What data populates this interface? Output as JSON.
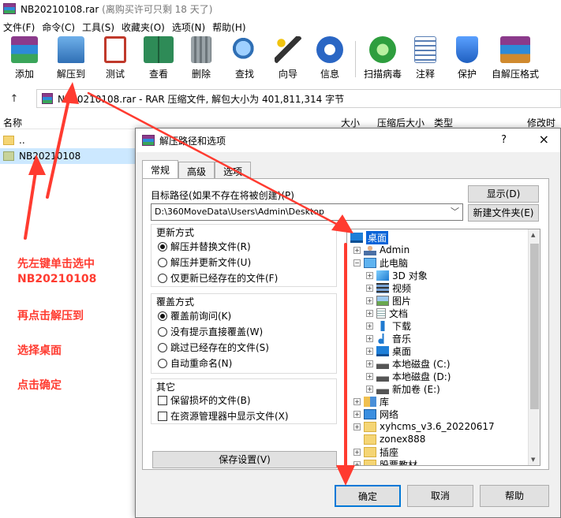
{
  "window": {
    "title": "NB20210108.rar",
    "subtitle": "(离购买许可只剩 18 天了)"
  },
  "menu": [
    "文件(F)",
    "命令(C)",
    "工具(S)",
    "收藏夹(O)",
    "选项(N)",
    "帮助(H)"
  ],
  "toolbar": [
    {
      "label": "添加",
      "icon": "add-icon",
      "color": "#8b3a8b"
    },
    {
      "label": "解压到",
      "icon": "extract-to-icon",
      "color": "#3d7ec9"
    },
    {
      "label": "测试",
      "icon": "test-icon",
      "color": "#c0392b"
    },
    {
      "label": "查看",
      "icon": "view-book-icon",
      "color": "#2e8b57"
    },
    {
      "label": "删除",
      "icon": "delete-trash-icon",
      "color": "#7f8c8d"
    },
    {
      "label": "查找",
      "icon": "find-magnifier-icon",
      "color": "#2f6fb5"
    },
    {
      "label": "向导",
      "icon": "wizard-wand-icon",
      "color": "#444444"
    },
    {
      "label": "信息",
      "icon": "info-icon",
      "color": "#2a66c4"
    },
    {
      "label": "扫描病毒",
      "icon": "scan-virus-icon",
      "color": "#2e9e3e"
    },
    {
      "label": "注释",
      "icon": "comment-icon",
      "color": "#5a7fb5"
    },
    {
      "label": "保护",
      "icon": "protect-shield-icon",
      "color": "#2b6fd6"
    },
    {
      "label": "自解压格式",
      "icon": "sfx-icon",
      "color": "#b5651d"
    }
  ],
  "address": {
    "text": "NB20210108.rar - RAR 压缩文件, 解包大小为 401,811,314 字节"
  },
  "file_columns": {
    "name": "名称",
    "size": "大小",
    "packed": "压缩后大小",
    "type": "类型",
    "modified": "修改时间"
  },
  "files": [
    {
      "name": ".."
    },
    {
      "name": "NB20210108"
    }
  ],
  "annotations": {
    "line1": "先左键单击选中",
    "line2": "NB20210108",
    "line3": "再点击解压到",
    "line4": "选择桌面",
    "line5": "点击确定"
  },
  "dialog": {
    "title": "解压路径和选项",
    "help": "?",
    "close": "×",
    "tabs": [
      "常规",
      "高级",
      "选项"
    ],
    "target_label": "目标路径(如果不存在将被创建)(P)",
    "target_value": "D:\\360MoveData\\Users\\Admin\\Desktop",
    "show_button": "显示(D)",
    "new_folder_button": "新建文件夹(E)",
    "update_mode": {
      "title": "更新方式",
      "options": [
        "解压并替换文件(R)",
        "解压并更新文件(U)",
        "仅更新已经存在的文件(F)"
      ]
    },
    "overwrite_mode": {
      "title": "覆盖方式",
      "options": [
        "覆盖前询问(K)",
        "没有提示直接覆盖(W)",
        "跳过已经存在的文件(S)",
        "自动重命名(N)"
      ]
    },
    "misc": {
      "title": "其它",
      "options": [
        "保留损坏的文件(B)",
        "在资源管理器中显示文件(X)"
      ]
    },
    "save_settings": "保存设置(V)",
    "tree": [
      {
        "label": "桌面",
        "level": 0
      },
      {
        "label": "Admin",
        "level": 1
      },
      {
        "label": "此电脑",
        "level": 1
      },
      {
        "label": "3D 对象",
        "level": 2
      },
      {
        "label": "视频",
        "level": 2
      },
      {
        "label": "图片",
        "level": 2
      },
      {
        "label": "文档",
        "level": 2
      },
      {
        "label": "下载",
        "level": 2
      },
      {
        "label": "音乐",
        "level": 2
      },
      {
        "label": "桌面",
        "level": 2
      },
      {
        "label": "本地磁盘 (C:)",
        "level": 2
      },
      {
        "label": "本地磁盘 (D:)",
        "level": 2
      },
      {
        "label": "新加卷 (E:)",
        "level": 2
      },
      {
        "label": "库",
        "level": 1
      },
      {
        "label": "网络",
        "level": 1
      },
      {
        "label": "xyhcms_v3.6_20220617",
        "level": 1
      },
      {
        "label": "zonex888",
        "level": 1
      },
      {
        "label": "插座",
        "level": 1
      },
      {
        "label": "股票教材",
        "level": 1
      }
    ],
    "ok": "确定",
    "cancel": "取消",
    "help_button": "帮助"
  },
  "colors": {
    "annotation_red": "#ff3b30",
    "selection": "#0a64d8",
    "ok_border": "#0078d7"
  }
}
